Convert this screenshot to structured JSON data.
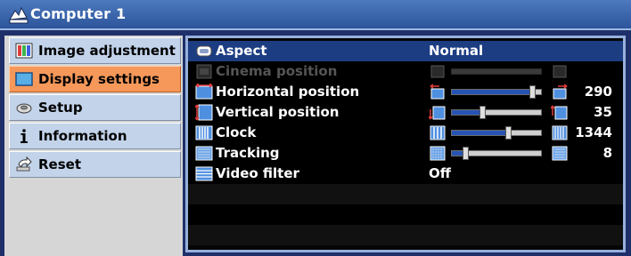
{
  "window": {
    "title": "Computer 1"
  },
  "sidebar": {
    "items": [
      {
        "label": "Image adjustment",
        "icon": "image-adjustment-icon",
        "selected": false
      },
      {
        "label": "Display settings",
        "icon": "display-settings-icon",
        "selected": true
      },
      {
        "label": "Setup",
        "icon": "setup-icon",
        "selected": false
      },
      {
        "label": "Information",
        "icon": "information-icon",
        "selected": false
      },
      {
        "label": "Reset",
        "icon": "reset-icon",
        "selected": false
      }
    ]
  },
  "settings": {
    "aspect": {
      "label": "Aspect",
      "value": "Normal",
      "icon": "aspect-icon"
    },
    "cinema_position": {
      "label": "Cinema position",
      "icon": "cinema-position-icon",
      "enabled": false
    },
    "horizontal_position": {
      "label": "Horizontal position",
      "value": "290",
      "level": 0.94,
      "icon": "horizontal-position-icon"
    },
    "vertical_position": {
      "label": "Vertical position",
      "value": "35",
      "level": 0.33,
      "icon": "vertical-position-icon"
    },
    "clock": {
      "label": "Clock",
      "value": "1344",
      "level": 0.65,
      "icon": "clock-icon"
    },
    "tracking": {
      "label": "Tracking",
      "value": "8",
      "level": 0.13,
      "icon": "tracking-icon"
    },
    "video_filter": {
      "label": "Video filter",
      "value": "Off",
      "icon": "video-filter-icon"
    }
  },
  "colors": {
    "title_bar": "#3a66ad",
    "selected_tab": "#f5985a",
    "tab": "#c2d3ea",
    "panel_bg": "#000000",
    "selected_row": "#1c3d82",
    "slider_fill": "#2754b4"
  }
}
